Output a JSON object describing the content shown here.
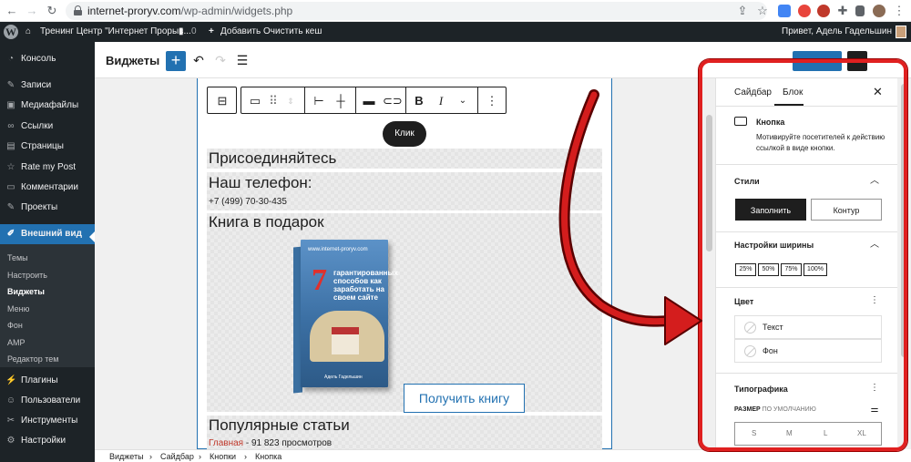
{
  "browser": {
    "url_domain": "internet-proryv.com",
    "url_path": "/wp-admin/widgets.php"
  },
  "admin_bar": {
    "site_name": "Тренинг Центр \"Интернет Прорыв...",
    "comments_count": "0",
    "add_new": "Добавить",
    "clear_cache": "Очистить кеш",
    "greeting": "Привет, Адель Гадельшин"
  },
  "sidebar": {
    "items": [
      {
        "label": "Консоль",
        "icon": "dashboard-icon"
      },
      {
        "label": "Записи",
        "icon": "pin-icon"
      },
      {
        "label": "Медиафайлы",
        "icon": "media-icon"
      },
      {
        "label": "Ссылки",
        "icon": "link-icon"
      },
      {
        "label": "Страницы",
        "icon": "pages-icon"
      },
      {
        "label": "Rate my Post",
        "icon": "star-icon"
      },
      {
        "label": "Комментарии",
        "icon": "comment-icon"
      },
      {
        "label": "Проекты",
        "icon": "pin-icon"
      },
      {
        "label": "Внешний вид",
        "icon": "brush-icon"
      }
    ],
    "submenu": [
      "Темы",
      "Настроить",
      "Виджеты",
      "Меню",
      "Фон",
      "AMP",
      "Редактор тем"
    ],
    "bottom_items": [
      {
        "label": "Плагины",
        "icon": "plugin-icon"
      },
      {
        "label": "Пользователи",
        "icon": "users-icon"
      },
      {
        "label": "Инструменты",
        "icon": "tools-icon"
      },
      {
        "label": "Настройки",
        "icon": "settings-icon"
      }
    ]
  },
  "editor": {
    "title": "Виджеты",
    "tooltip": "Клик",
    "widgets": {
      "join": "Присоединяйтесь",
      "phone_title": "Наш телефон:",
      "phone": "+7 (499) 70-30-435",
      "book_title": "Книга в подарок",
      "button": "Получить книгу",
      "popular_title": "Популярные статьи",
      "popular_link": "Главная",
      "popular_views": " - 91 823 просмотров"
    },
    "book": {
      "url": "www.internet-proryv.com",
      "number": "7",
      "title": "гарантированных способов как заработать на своем сайте",
      "author": "Адель Гадельшин"
    }
  },
  "breadcrumb": [
    "Виджеты",
    "Сайдбар",
    "Кнопки",
    "Кнопка"
  ],
  "panel": {
    "tab_sidebar": "Сайдбар",
    "tab_block": "Блок",
    "block_name": "Кнопка",
    "block_desc": "Мотивируйте посетителей к действию ссылкой в виде кнопки.",
    "styles_title": "Стили",
    "style_fill": "Заполнить",
    "style_outline": "Контур",
    "width_title": "Настройки ширины",
    "widths": [
      "25%",
      "50%",
      "75%",
      "100%"
    ],
    "color_title": "Цвет",
    "color_text": "Текст",
    "color_bg": "Фон",
    "typo_title": "Типографика",
    "size_label": "РАЗМЕР",
    "size_default": "ПО УМОЛЧАНИЮ",
    "sizes": [
      "S",
      "M",
      "L",
      "XL"
    ]
  },
  "colors": {
    "wp_blue": "#2271b1",
    "admin_dark": "#1d2327",
    "annotation_red": "#e02020"
  }
}
